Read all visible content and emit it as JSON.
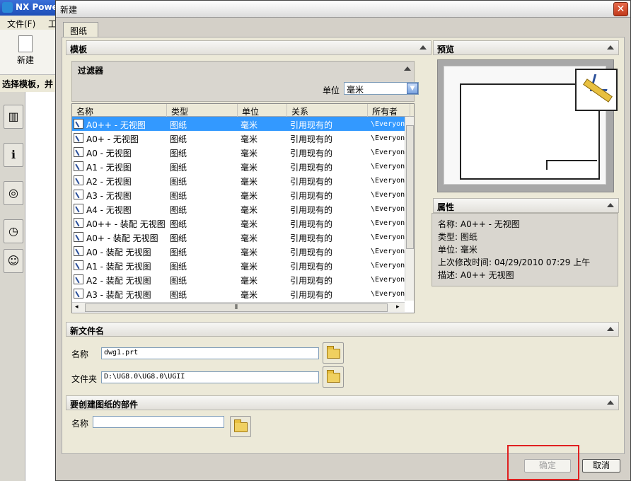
{
  "background_app": {
    "title": "NX Powe",
    "menu": [
      "文件(F)",
      "工"
    ],
    "new_label": "新建",
    "cue_text": "选择模板，并"
  },
  "dialog": {
    "title": "新建",
    "close_glyph": "✕",
    "tab": "图纸",
    "templates_section": "模板",
    "filter_section": "过滤器",
    "unit_label": "单位",
    "unit_value": "毫米",
    "columns": [
      "名称",
      "类型",
      "单位",
      "关系",
      "所有者"
    ],
    "rows": [
      {
        "name": "A0++ - 无视图",
        "type": "图纸",
        "unit": "毫米",
        "relation": "引用现有的",
        "owner": "\\Everyone"
      },
      {
        "name": "A0+ - 无视图",
        "type": "图纸",
        "unit": "毫米",
        "relation": "引用现有的",
        "owner": "\\Everyone"
      },
      {
        "name": "A0 - 无视图",
        "type": "图纸",
        "unit": "毫米",
        "relation": "引用现有的",
        "owner": "\\Everyone"
      },
      {
        "name": "A1 - 无视图",
        "type": "图纸",
        "unit": "毫米",
        "relation": "引用现有的",
        "owner": "\\Everyone"
      },
      {
        "name": "A2 - 无视图",
        "type": "图纸",
        "unit": "毫米",
        "relation": "引用现有的",
        "owner": "\\Everyone"
      },
      {
        "name": "A3 - 无视图",
        "type": "图纸",
        "unit": "毫米",
        "relation": "引用现有的",
        "owner": "\\Everyone"
      },
      {
        "name": "A4 - 无视图",
        "type": "图纸",
        "unit": "毫米",
        "relation": "引用现有的",
        "owner": "\\Everyone"
      },
      {
        "name": "A0++ - 装配 无视图",
        "type": "图纸",
        "unit": "毫米",
        "relation": "引用现有的",
        "owner": "\\Everyone"
      },
      {
        "name": "A0+ - 装配 无视图",
        "type": "图纸",
        "unit": "毫米",
        "relation": "引用现有的",
        "owner": "\\Everyone"
      },
      {
        "name": "A0 - 装配 无视图",
        "type": "图纸",
        "unit": "毫米",
        "relation": "引用现有的",
        "owner": "\\Everyone"
      },
      {
        "name": "A1 - 装配 无视图",
        "type": "图纸",
        "unit": "毫米",
        "relation": "引用现有的",
        "owner": "\\Everyone"
      },
      {
        "name": "A2 - 装配 无视图",
        "type": "图纸",
        "unit": "毫米",
        "relation": "引用现有的",
        "owner": "\\Everyone"
      },
      {
        "name": "A3 - 装配 无视图",
        "type": "图纸",
        "unit": "毫米",
        "relation": "引用现有的",
        "owner": "\\Everyone"
      }
    ],
    "preview_section": "预览",
    "properties_section": "属性",
    "properties": [
      "名称:  A0++ - 无视图",
      "类型:  图纸",
      "单位:  毫米",
      "上次修改时间:  04/29/2010 07:29 上午",
      "描述:  A0++ 无视图"
    ],
    "new_file_section": "新文件名",
    "name_label": "名称",
    "name_value": "dwg1.prt",
    "folder_label": "文件夹",
    "folder_value": "D:\\UG8.0\\UG8.0\\UGII",
    "part_section": "要创建图纸的部件",
    "part_name_label": "名称",
    "part_name_value": "",
    "ok": "确定",
    "cancel": "取消",
    "selected_row": 0
  },
  "colors": {
    "selection": "#3399ff",
    "highlight": "#e02020"
  }
}
